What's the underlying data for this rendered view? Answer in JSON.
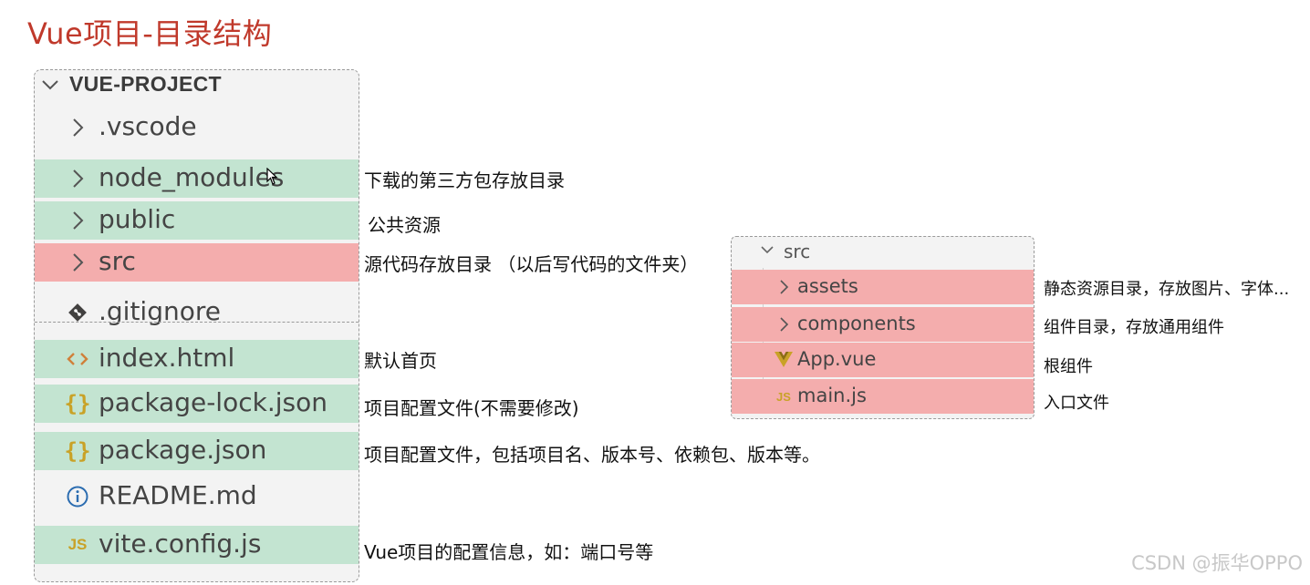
{
  "title": "Vue项目-目录结构",
  "explorer": {
    "header": "VUE-PROJECT",
    "items": [
      {
        "label": ".vscode",
        "icon": "chevron-right-icon",
        "highlight": "none"
      },
      {
        "label": "node_modules",
        "icon": "chevron-right-icon",
        "highlight": "green"
      },
      {
        "label": "public",
        "icon": "chevron-right-icon",
        "highlight": "green"
      },
      {
        "label": "src",
        "icon": "chevron-right-icon",
        "highlight": "red"
      },
      {
        "label": ".gitignore",
        "icon": "git-icon",
        "highlight": "none"
      },
      {
        "label": "index.html",
        "icon": "html-code-icon",
        "highlight": "green"
      },
      {
        "label": "package-lock.json",
        "icon": "json-braces-icon",
        "highlight": "green"
      },
      {
        "label": "package.json",
        "icon": "json-braces-icon",
        "highlight": "green"
      },
      {
        "label": "README.md",
        "icon": "info-icon",
        "highlight": "none"
      },
      {
        "label": "vite.config.js",
        "icon": "js-icon",
        "highlight": "green"
      }
    ]
  },
  "annotations": {
    "node_modules": "下载的第三方包存放目录",
    "public": "公共资源",
    "src": "源代码存放目录 （以后写代码的文件夹）",
    "index": "默认首页",
    "package_lock": "项目配置文件(不需要修改)",
    "package": "项目配置文件，包括项目名、版本号、依赖包、版本等。",
    "vite_config": "Vue项目的配置信息，如：端口号等"
  },
  "src_tree": {
    "header": "src",
    "items": [
      {
        "label": "assets",
        "icon": "chevron-right-icon"
      },
      {
        "label": "components",
        "icon": "chevron-right-icon"
      },
      {
        "label": "App.vue",
        "icon": "vue-icon"
      },
      {
        "label": "main.js",
        "icon": "js-icon"
      }
    ]
  },
  "src_annotations": {
    "assets": "静态资源目录，存放图片、字体...",
    "components": "组件目录，存放通用组件",
    "app": "根组件",
    "main": "入口文件"
  },
  "watermark": "CSDN @振华OPPO",
  "colors": {
    "title": "#c0392b",
    "green_highlight": "#c3e4d1",
    "red_highlight": "#f4adad",
    "panel_bg": "#f3f3f3",
    "json_icon": "#c9a227",
    "js_icon": "#c9a227",
    "vue_icon": "#c9a227",
    "html_icon": "#d0803a",
    "info_icon": "#2b6cb0"
  }
}
